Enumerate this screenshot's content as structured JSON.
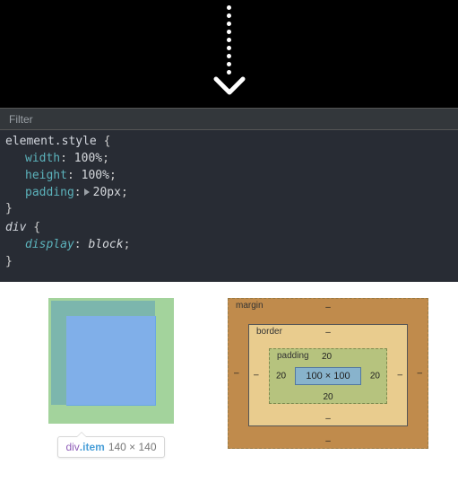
{
  "filter": {
    "placeholder": "Filter"
  },
  "css_rules": [
    {
      "selector": "element.style",
      "italic": false,
      "declarations": [
        {
          "prop": "width",
          "val": "100%",
          "expandable": false
        },
        {
          "prop": "height",
          "val": "100%",
          "expandable": false
        },
        {
          "prop": "padding",
          "val": "20px",
          "expandable": true
        }
      ]
    },
    {
      "selector": "div",
      "italic": true,
      "declarations": [
        {
          "prop": "display",
          "val": "block",
          "expandable": false
        }
      ]
    }
  ],
  "tooltip": {
    "tag": "div",
    "cls": ".item",
    "dims": "140 × 140"
  },
  "box_model": {
    "margin": {
      "label": "margin",
      "top": "–",
      "right": "–",
      "bottom": "–",
      "left": "–"
    },
    "border": {
      "label": "border",
      "top": "–",
      "right": "–",
      "bottom": "–",
      "left": "–"
    },
    "padding": {
      "label": "padding",
      "top": "20",
      "right": "20",
      "bottom": "20",
      "left": "20"
    },
    "content": "100 × 100"
  }
}
